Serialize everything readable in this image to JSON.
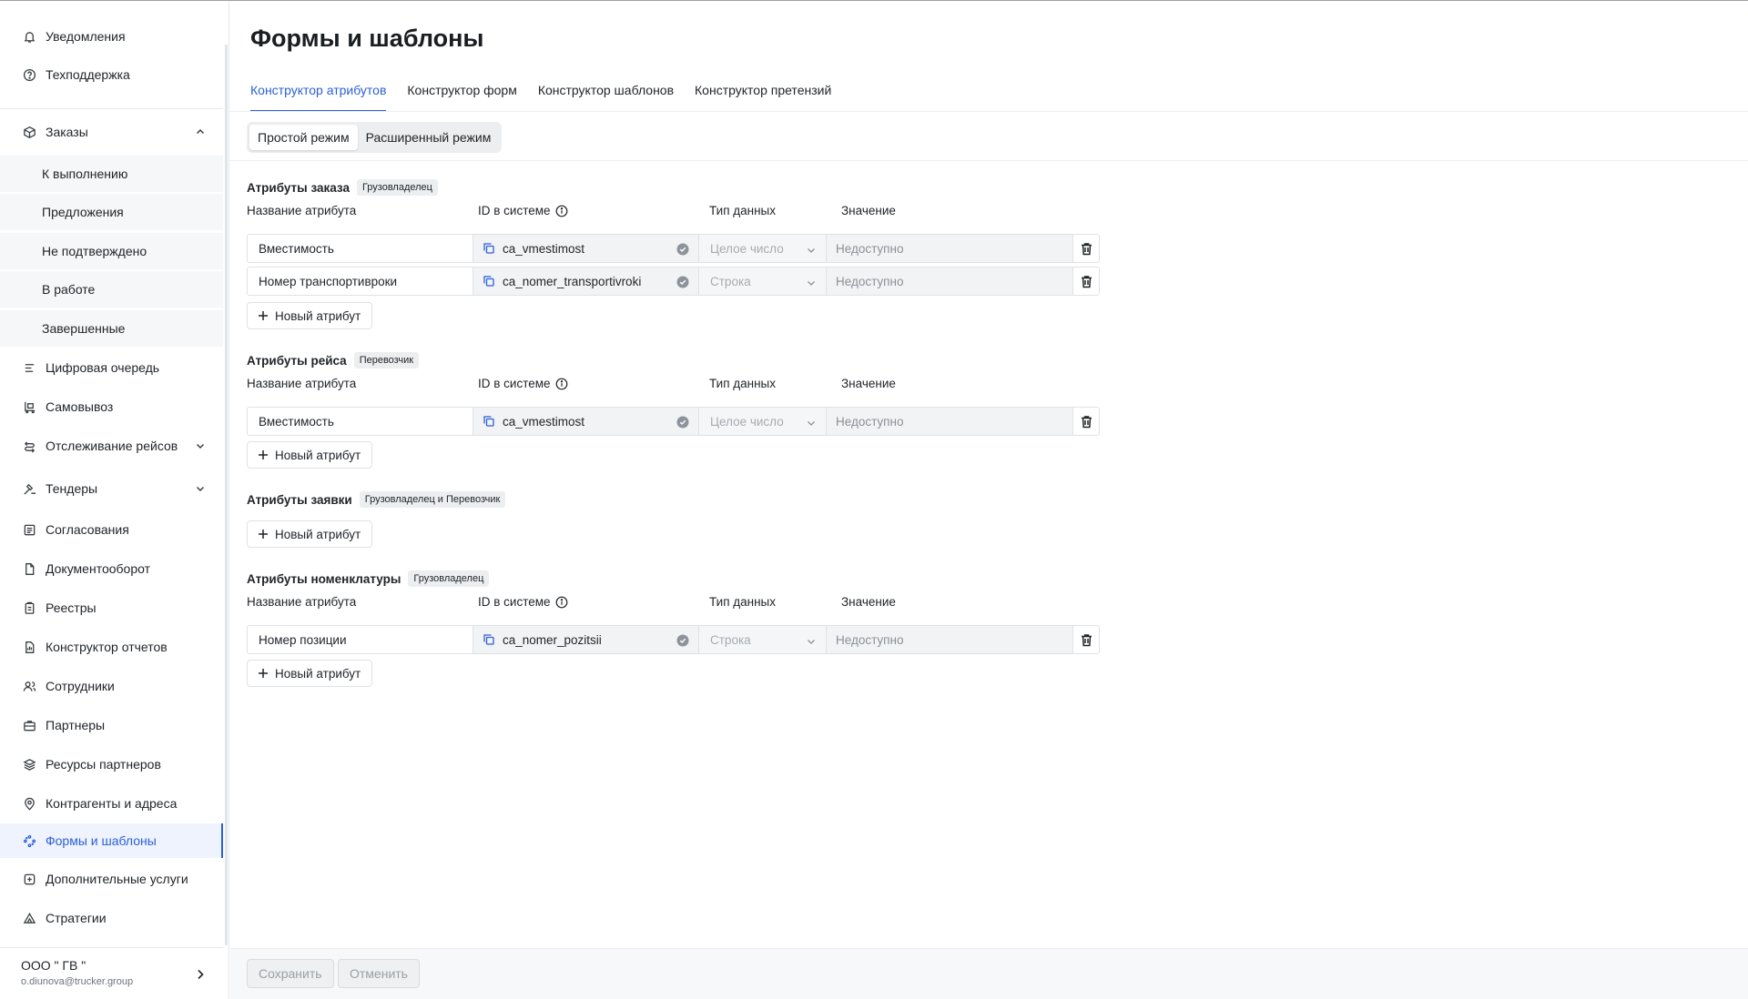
{
  "sidebar": {
    "top_items": [
      {
        "label": "Уведомления",
        "icon": "bell-icon"
      },
      {
        "label": "Техподдержка",
        "icon": "help-circle-icon"
      }
    ],
    "orders": {
      "label": "Заказы",
      "icon": "box-icon",
      "sub": [
        "К выполнению",
        "Предложения",
        "Не подтверждено",
        "В работе",
        "Завершенные"
      ]
    },
    "items": [
      {
        "label": "Цифровая очередь",
        "icon": "queue-icon"
      },
      {
        "label": "Самовывоз",
        "icon": "pickup-icon"
      },
      {
        "label": "Отслеживание рейсов",
        "icon": "route-icon"
      },
      {
        "label": "Тендеры",
        "icon": "hammer-icon"
      },
      {
        "label": "Согласования",
        "icon": "approvals-icon"
      },
      {
        "label": "Документооборот",
        "icon": "document-icon"
      },
      {
        "label": "Реестры",
        "icon": "registry-icon"
      },
      {
        "label": "Конструктор отчетов",
        "icon": "report-icon"
      },
      {
        "label": "Сотрудники",
        "icon": "users-icon"
      },
      {
        "label": "Партнеры",
        "icon": "briefcase-icon"
      },
      {
        "label": "Ресурсы партнеров",
        "icon": "layers-icon"
      },
      {
        "label": "Контрагенты и адреса",
        "icon": "map-pin-icon"
      },
      {
        "label": "Формы и шаблоны",
        "icon": "forms-icon"
      },
      {
        "label": "Дополнительные услуги",
        "icon": "plus-square-icon"
      },
      {
        "label": "Стратегии",
        "icon": "strategy-icon"
      }
    ],
    "account": {
      "org": "ООО \" ГВ \"",
      "email": "o.diunova@trucker.group"
    }
  },
  "page": {
    "title": "Формы и шаблоны"
  },
  "tabs": [
    "Конструктор атрибутов",
    "Конструктор форм",
    "Конструктор шаблонов",
    "Конструктор претензий"
  ],
  "modes": [
    "Простой режим",
    "Расширенный режим"
  ],
  "columns": {
    "name": "Название атрибута",
    "sysid": "ID в системе",
    "dtype": "Тип данных",
    "value": "Значение"
  },
  "sections": [
    {
      "title": "Атрибуты заказа",
      "badge": "Грузовладелец",
      "rows": [
        {
          "name": "Вместимость",
          "sysid": "ca_vmestimost",
          "dtype": "Целое число",
          "value": "Недоступно"
        },
        {
          "name": "Номер транспортивроки",
          "sysid": "ca_nomer_transportivroki",
          "dtype": "Строка",
          "value": "Недоступно"
        }
      ]
    },
    {
      "title": "Атрибуты рейса",
      "badge": "Перевозчик",
      "rows": [
        {
          "name": "Вместимость",
          "sysid": "ca_vmestimost",
          "dtype": "Целое число",
          "value": "Недоступно"
        }
      ]
    },
    {
      "title": "Атрибуты заявки",
      "badge": "Грузовладелец и Перевозчик",
      "rows": []
    },
    {
      "title": "Атрибуты номенклатуры",
      "badge": "Грузовладелец",
      "rows": [
        {
          "name": "Номер позиции",
          "sysid": "ca_nomer_pozitsii",
          "dtype": "Строка",
          "value": "Недоступно"
        }
      ]
    }
  ],
  "add_label": "Новый атрибут",
  "footer": {
    "save": "Сохранить",
    "cancel": "Отменить"
  },
  "colors": {
    "accent": "#2b5fd9",
    "active_bg": "#eef3fd",
    "muted": "#9aa0a7"
  }
}
